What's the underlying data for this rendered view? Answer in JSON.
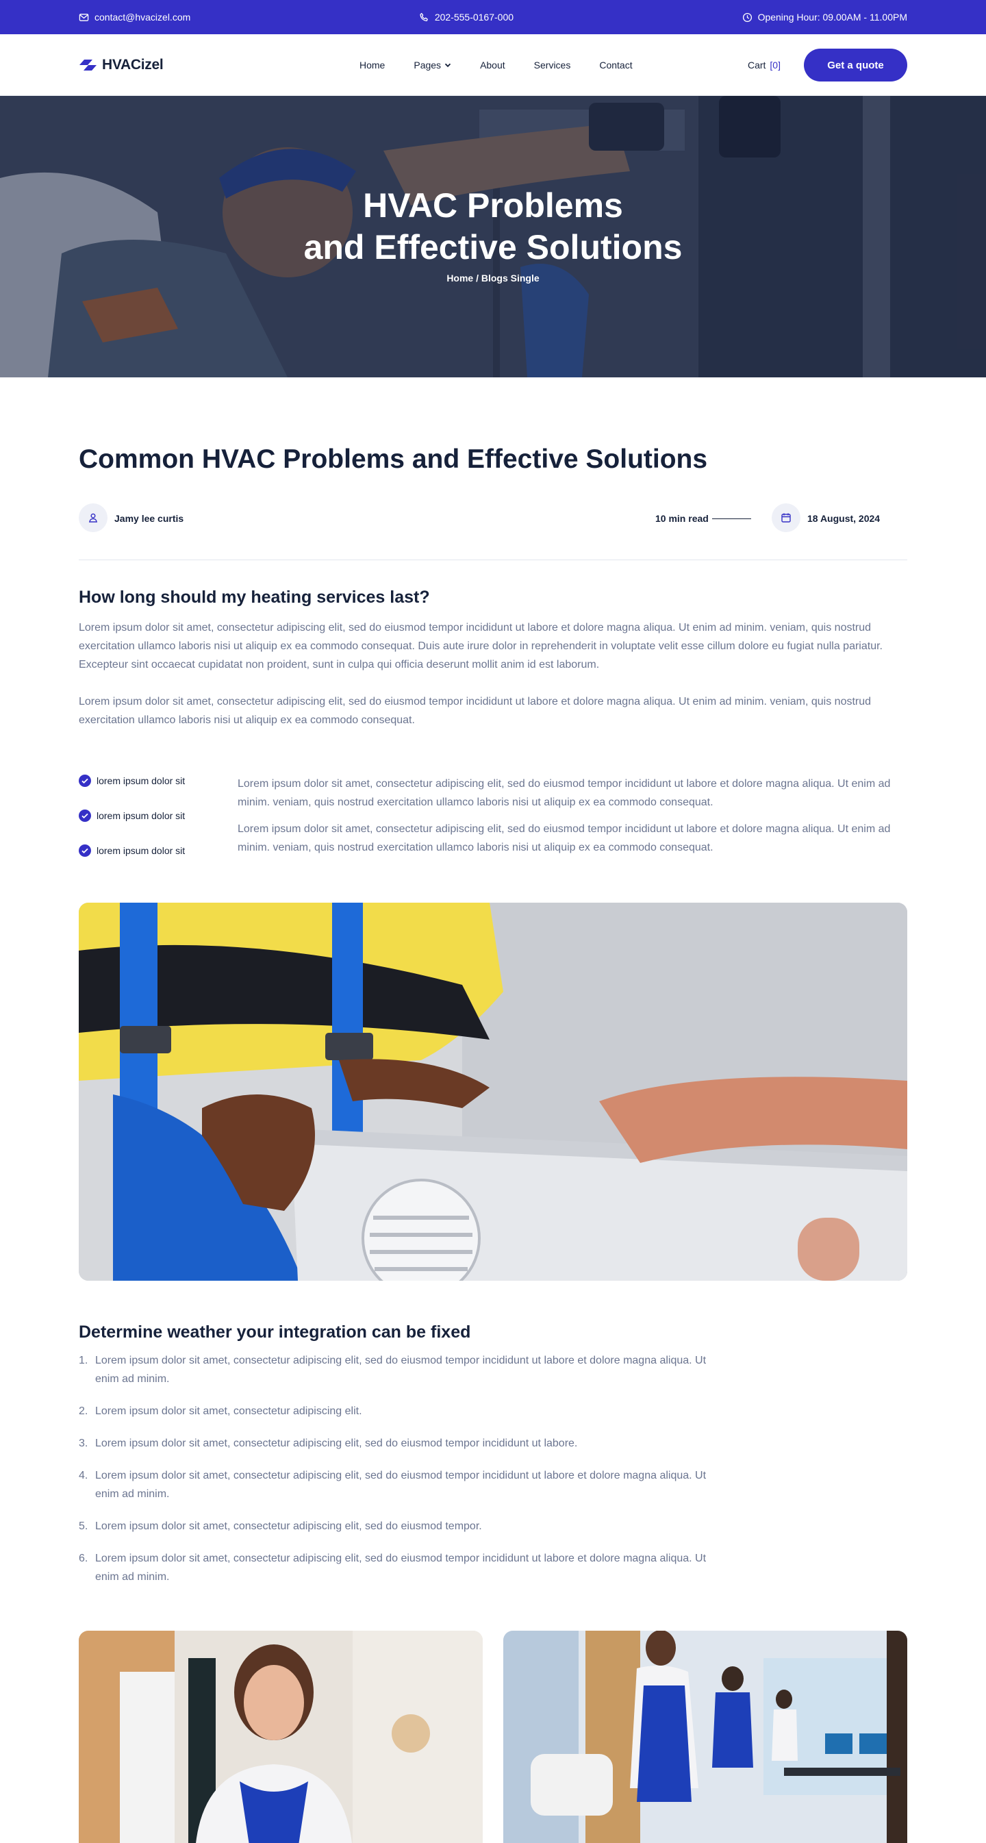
{
  "topbar": {
    "email": "contact@hvacizel.com",
    "phone": "202-555-0167-000",
    "hours": "Opening Hour: 09.00AM - 11.00PM"
  },
  "brand": {
    "name": "HVACizel",
    "accent": "#3530c6",
    "text": "#16213a",
    "muted": "#6b7590"
  },
  "nav": {
    "items": [
      "Home",
      "Pages",
      "About",
      "Services",
      "Contact"
    ],
    "cart_label": "Cart",
    "cart_count": "[0]",
    "cta": "Get a quote"
  },
  "hero": {
    "title_line1": "HVAC Problems",
    "title_line2": "and Effective Solutions",
    "breadcrumb": "Home / Blogs Single"
  },
  "article": {
    "title": "Common HVAC Problems and Effective Solutions",
    "author": "Jamy lee curtis",
    "read_time": "10 min read",
    "date": "18 August, 2024",
    "section1_heading": "How long should my heating services last?",
    "section1_p1": "Lorem ipsum dolor sit amet, consectetur adipiscing elit, sed do eiusmod tempor incididunt ut labore et dolore magna aliqua. Ut enim ad minim. veniam, quis nostrud exercitation ullamco laboris nisi ut aliquip ex ea commodo consequat. Duis aute irure dolor in reprehenderit in voluptate velit esse cillum dolore eu fugiat nulla pariatur. Excepteur sint occaecat cupidatat non proident, sunt in culpa qui officia deserunt mollit anim id est laborum.",
    "section1_p2": "Lorem ipsum dolor sit amet, consectetur adipiscing elit, sed do eiusmod tempor incididunt ut labore et dolore magna aliqua. Ut enim ad minim. veniam, quis nostrud exercitation ullamco laboris nisi ut aliquip ex ea commodo consequat.",
    "checklist": [
      "lorem ipsum dolor sit",
      "lorem ipsum dolor sit",
      "lorem ipsum dolor sit"
    ],
    "side_p1": "Lorem ipsum dolor sit amet, consectetur adipiscing elit, sed do eiusmod tempor incididunt ut labore et dolore magna aliqua. Ut enim ad minim. veniam, quis nostrud exercitation ullamco laboris nisi ut aliquip ex ea commodo consequat.",
    "side_p2": "Lorem ipsum dolor sit amet, consectetur adipiscing elit, sed do eiusmod tempor incididunt ut labore et dolore magna aliqua. Ut enim ad minim. veniam, quis nostrud exercitation ullamco laboris nisi ut aliquip ex ea commodo consequat.",
    "section2_heading": "Determine weather your integration can be fixed",
    "steps": [
      "Lorem ipsum dolor sit amet, consectetur adipiscing elit, sed do eiusmod tempor incididunt ut labore et dolore magna aliqua. Ut enim ad minim.",
      "Lorem ipsum dolor sit amet, consectetur adipiscing elit.",
      "Lorem ipsum dolor sit amet, consectetur adipiscing elit, sed do eiusmod tempor incididunt ut labore.",
      "Lorem ipsum dolor sit amet, consectetur adipiscing elit, sed do eiusmod tempor incididunt ut labore et dolore magna aliqua. Ut enim ad minim.",
      "Lorem ipsum dolor sit amet, consectetur adipiscing elit, sed do eiusmod tempor.",
      "Lorem ipsum dolor sit amet, consectetur adipiscing elit, sed do eiusmod tempor incididunt ut labore et dolore magna aliqua. Ut enim ad minim."
    ],
    "step_numbers": [
      "1.",
      "2.",
      "3.",
      "4.",
      "5.",
      "6."
    ]
  }
}
